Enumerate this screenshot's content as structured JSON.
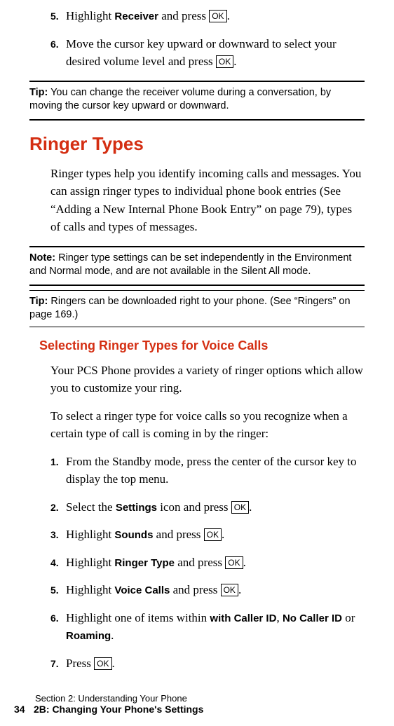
{
  "ok_label": "OK",
  "steps_top": [
    {
      "num": "5.",
      "pre": "Highlight ",
      "bold": "Receiver",
      "post": " and press ",
      "hasOK": true,
      "tail": "."
    },
    {
      "num": "6.",
      "pre": "Move the cursor key upward or downward to select your desired volume level and press ",
      "hasOK": true,
      "tail": "."
    }
  ],
  "tip1": {
    "label": "Tip:",
    "text": " You can change the receiver volume during a conversation, by moving the cursor key upward or downward."
  },
  "h1": "Ringer Types",
  "para1": "Ringer types help you identify incoming calls and messages. You can assign ringer types to individual phone book entries (See “Adding a New Internal Phone Book Entry” on page 79), types of calls and types of messages.",
  "note1": {
    "label": "Note:",
    "text": " Ringer type settings can be set independently in the Environment and Normal mode, and are not available in the Silent All mode."
  },
  "tip2": {
    "label": "Tip:",
    "text": " Ringers can be downloaded right to your phone. (See “Ringers” on page 169.)"
  },
  "h2": "Selecting Ringer Types for Voice Calls",
  "para2": "Your PCS Phone provides a variety of ringer options which allow you to customize your ring.",
  "para3": "To select a ringer type for voice calls so you recognize when a certain type of call is coming in by the ringer:",
  "steps_main": [
    {
      "num": "1.",
      "text": "From the Standby mode, press the center of the cursor key to display the top menu."
    },
    {
      "num": "2.",
      "pre": "Select the ",
      "bold": "Settings",
      "post": " icon and press ",
      "hasOK": true,
      "tail": "."
    },
    {
      "num": "3.",
      "pre": "Highlight ",
      "bold": "Sounds",
      "post": " and press ",
      "hasOK": true,
      "tail": "."
    },
    {
      "num": "4.",
      "pre": "Highlight ",
      "bold": "Ringer Type",
      "post": " and press ",
      "hasOK": true,
      "tail": "."
    },
    {
      "num": "5.",
      "pre": "Highlight ",
      "bold": "Voice Calls",
      "post": " and press ",
      "hasOK": true,
      "tail": "."
    }
  ],
  "step6": {
    "num": "6.",
    "pre": "Highlight one of items within ",
    "b1": "with Caller ID",
    "sep1": ", ",
    "b2": "No Caller ID",
    "sep2": " or ",
    "b3": "Roaming",
    "tail": "."
  },
  "step7": {
    "num": "7.",
    "pre": "Press ",
    "tail": "."
  },
  "footer": {
    "line1": "Section 2: Understanding Your Phone",
    "pagenum": "34",
    "line2": "2B: Changing Your Phone's Settings"
  }
}
